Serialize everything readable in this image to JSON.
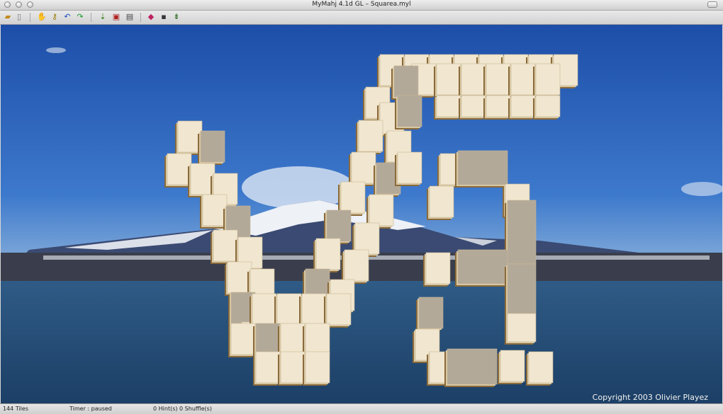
{
  "window": {
    "title": "MyMahj 4.1d GL – Squarea.myl"
  },
  "toolbar": {
    "icons": [
      "open-folder-icon",
      "new-document-icon",
      "hand-icon",
      "key-icon",
      "undo-icon",
      "redo-icon",
      "hint-arrow-icon",
      "shuffle-icon",
      "layout-icon",
      "eraser-icon",
      "save-icon",
      "export-icon"
    ]
  },
  "game": {
    "copyright": "Copyright 2003 Olivier Playez",
    "tile_face_color": "#f1e6cf",
    "tile_dark_color": "#b3a999"
  },
  "status": {
    "tiles": "144 Tiles",
    "timer": "Timer : paused",
    "hints": "0 Hint(s) 0 Shuffle(s)"
  }
}
